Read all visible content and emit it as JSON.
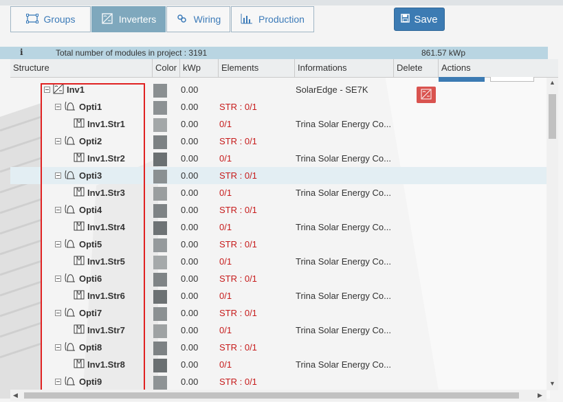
{
  "tabs": [
    {
      "label": "Groups",
      "icon": "groups-icon",
      "active": false
    },
    {
      "label": "Inverters",
      "icon": "inverter-icon",
      "active": true
    },
    {
      "label": "Wiring",
      "icon": "wiring-icon",
      "active": false
    },
    {
      "label": "Production",
      "icon": "production-icon",
      "active": false
    }
  ],
  "save_label": "Save",
  "info": {
    "icon": "i",
    "modules_text": "Total number of modules in project : 3191",
    "kwp_text": "861.57 kWp"
  },
  "columns": [
    "Structure",
    "Color",
    "kWp",
    "Elements",
    "Informations",
    "Delete",
    "Actions"
  ],
  "rows": [
    {
      "type": "inverter",
      "name": "Inv1",
      "color": "#8a8f91",
      "kwp": "0.00",
      "elements": "",
      "info": "SolarEdge - SE7K",
      "delete": true
    },
    {
      "type": "optimizer",
      "name": "Opti1",
      "color": "#8c9193",
      "kwp": "0.00",
      "elements": "STR : 0/1",
      "info": ""
    },
    {
      "type": "string",
      "name": "Inv1.Str1",
      "color": "#a3a7a8",
      "kwp": "0.00",
      "elements": "0/1",
      "info": "Trina Solar Energy Co..."
    },
    {
      "type": "optimizer",
      "name": "Opti2",
      "color": "#7c8183",
      "kwp": "0.00",
      "elements": "STR : 0/1",
      "info": ""
    },
    {
      "type": "string",
      "name": "Inv1.Str2",
      "color": "#6b7072",
      "kwp": "0.00",
      "elements": "0/1",
      "info": "Trina Solar Energy Co..."
    },
    {
      "type": "optimizer",
      "name": "Opti3",
      "color": "#8a9092",
      "kwp": "0.00",
      "elements": "STR : 0/1",
      "info": "",
      "highlight": true
    },
    {
      "type": "string",
      "name": "Inv1.Str3",
      "color": "#9a9e9f",
      "kwp": "0.00",
      "elements": "0/1",
      "info": "Trina Solar Energy Co..."
    },
    {
      "type": "optimizer",
      "name": "Opti4",
      "color": "#7e8385",
      "kwp": "0.00",
      "elements": "STR : 0/1",
      "info": ""
    },
    {
      "type": "string",
      "name": "Inv1.Str4",
      "color": "#6e7375",
      "kwp": "0.00",
      "elements": "0/1",
      "info": "Trina Solar Energy Co..."
    },
    {
      "type": "optimizer",
      "name": "Opti5",
      "color": "#959a9c",
      "kwp": "0.00",
      "elements": "STR : 0/1",
      "info": ""
    },
    {
      "type": "string",
      "name": "Inv1.Str5",
      "color": "#a5a9aa",
      "kwp": "0.00",
      "elements": "0/1",
      "info": "Trina Solar Energy Co..."
    },
    {
      "type": "optimizer",
      "name": "Opti6",
      "color": "#7f8486",
      "kwp": "0.00",
      "elements": "STR : 0/1",
      "info": ""
    },
    {
      "type": "string",
      "name": "Inv1.Str6",
      "color": "#6c7173",
      "kwp": "0.00",
      "elements": "0/1",
      "info": "Trina Solar Energy Co..."
    },
    {
      "type": "optimizer",
      "name": "Opti7",
      "color": "#8b9092",
      "kwp": "0.00",
      "elements": "STR : 0/1",
      "info": ""
    },
    {
      "type": "string",
      "name": "Inv1.Str7",
      "color": "#9ea2a3",
      "kwp": "0.00",
      "elements": "0/1",
      "info": "Trina Solar Energy Co..."
    },
    {
      "type": "optimizer",
      "name": "Opti8",
      "color": "#7d8284",
      "kwp": "0.00",
      "elements": "STR : 0/1",
      "info": ""
    },
    {
      "type": "string",
      "name": "Inv1.Str8",
      "color": "#6a6f71",
      "kwp": "0.00",
      "elements": "0/1",
      "info": "Trina Solar Energy Co..."
    },
    {
      "type": "optimizer",
      "name": "Opti9",
      "color": "#8e9395",
      "kwp": "0.00",
      "elements": "STR : 0/1",
      "info": ""
    }
  ]
}
